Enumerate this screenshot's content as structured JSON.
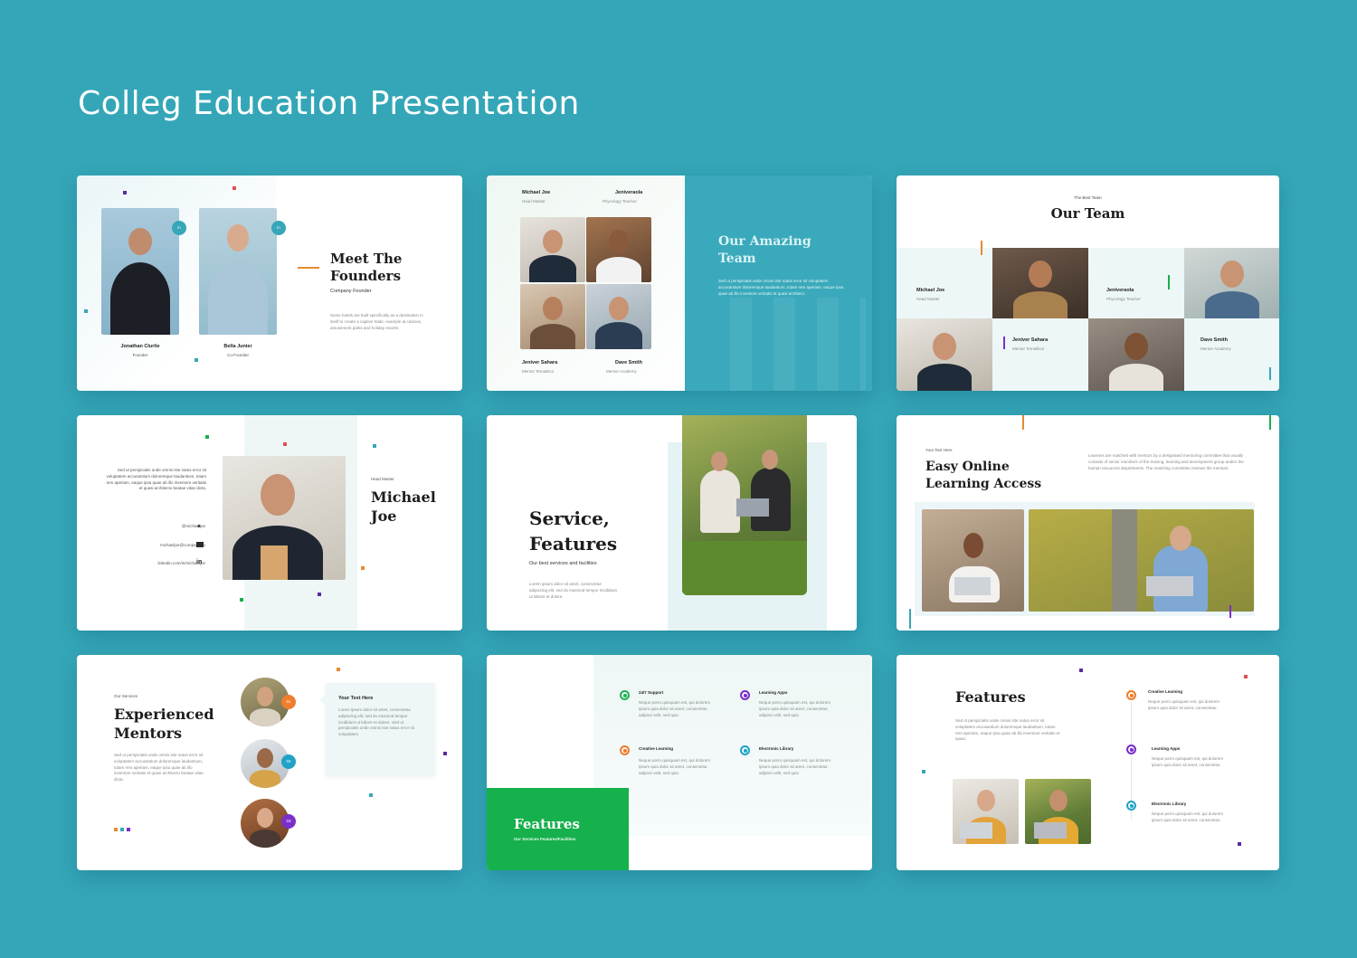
{
  "page": {
    "title": "Colleg Education Presentation"
  },
  "slides": {
    "founders": {
      "title_line1": "Meet The",
      "title_line2": "Founders",
      "subtitle": "Company Founder",
      "body": "Some hotels are built specifically as a destination in itself to create a captive trade, example at casinos, amusement parks and holiday resorts.",
      "people": [
        {
          "name": "Jonathan Clurlie",
          "role": "Founder",
          "badge": "in"
        },
        {
          "name": "Bella Junier",
          "role": "Co-Founder",
          "badge": "in"
        }
      ]
    },
    "amazing_team": {
      "title_line1": "Our Amazing",
      "title_line2": "Team",
      "body": "Sed ut perspiciatis unde omnis iste natus error sit voluptatem accusantium doloremque laudantium, totam rem aperiam, eaque ipsa quae ab illo inventore veritatis et quasi architect.",
      "members": [
        {
          "name": "Michael Joe",
          "role": "Head Master"
        },
        {
          "name": "Jeniveraola",
          "role": "Phycology Teacher"
        },
        {
          "name": "Jeniver Sahara",
          "role": "Mentor Tematikcs"
        },
        {
          "name": "Dave Smith",
          "role": "Mentor Academy"
        }
      ]
    },
    "our_team": {
      "eyebrow": "The Best Team",
      "title": "Our Team",
      "members": [
        {
          "name": "Michael Joe",
          "role": "Head Master"
        },
        {
          "name": "Jeniveraola",
          "role": "Phycology Teacher"
        },
        {
          "name": "Jeniver Sahara",
          "role": "Mentor Tematikcs"
        },
        {
          "name": "Dave Smith",
          "role": "Mentor Academy"
        }
      ]
    },
    "profile": {
      "eyebrow": "Head Master",
      "name_line1": "Michael",
      "name_line2": "Joe",
      "body": "Sed ut perspiciatis unde omnis iste natus error sit voluptatem accusantium doloremque laudantium, totam rem aperiam, eaque ipsa quae ab illo inventore veritatis et quasi architecto beatae vitae dicta.",
      "contacts": [
        {
          "text": "@michaeljoe",
          "icon": "twitter-icon"
        },
        {
          "text": "michaeljoe@company.co",
          "icon": "mail-icon"
        },
        {
          "text": "linkedin.com/in/michaeljoe",
          "icon": "linkedin-icon"
        }
      ]
    },
    "service": {
      "title_line1": "Service,",
      "title_line2": "Features",
      "subtitle": "Our best services and facilities",
      "body": "Lorem ipsum dolor sit amet, consectetur adipiscing elit, sed do eiusmod tempor incididunt ut labore et dolore."
    },
    "online": {
      "eyebrow": "Your Text Here",
      "title_line1": "Easy Online",
      "title_line2": "Learning Access",
      "body": "Learners are matched with mentors by a designated mentoring committee that usually consists of senior members of the training, learning and development group and/or the human resources departments. The matching committee reviews the mentors."
    },
    "mentors": {
      "eyebrow": "Our Services",
      "title_line1": "Experienced",
      "title_line2": "Mentors",
      "body": "Sed ut perspiciatis unde omnis iste natus error sit voluptatem accusantium doloremque laudantium, totam rem aperiam, eaque ipsa quae ab illo inventore veritatis et quasi architecto beatae vitae dicta.",
      "card_title": "Your Text Here",
      "card_body": "Lorem ipsum dolor sit amet, consectetur adipiscing elit, sed do eiusmod tempor incididunt ut labore et dolore. Sed ut perspiciatis unde omnis iste natus error sit voluptatem.",
      "badges": [
        "01",
        "02",
        "03"
      ]
    },
    "features_grid": {
      "title": "Features",
      "subtitle": "Our Services Features/Facilities",
      "items": [
        {
          "title": "24/7 Support",
          "body": "Neque porro quisquam est, qui dolorem ipsum quia dolor sit amet, consectetur, adipisci velit, sed quia",
          "color": "#22b159"
        },
        {
          "title": "Learning Apps",
          "body": "Neque porro quisquam est, qui dolorem ipsum quia dolor sit amet, consectetur, adipisci velit, sed quia",
          "color": "#7b2fc9"
        },
        {
          "title": "Creative Learning",
          "body": "Neque porro quisquam est, qui dolorem ipsum quia dolor sit amet, consectetur, adipisci velit, sed quia",
          "color": "#ef7d2c"
        },
        {
          "title": "Electronic Library",
          "body": "Neque porro quisquam est, qui dolorem ipsum quia dolor sit amet, consectetur, adipisci velit, sed quia",
          "color": "#1fa2c7"
        }
      ]
    },
    "features_list": {
      "title": "Features",
      "body": "Sed ut perspiciatis unde omnis iste natus error sit voluptatem accusantium doloremque laudantium, totam rem aperiam, eaque ipsa quae ab illo inventore veritatis et quasi.",
      "items": [
        {
          "title": "Creative Learning",
          "body": "Neque porro quisquam est, qui dolorem ipsum quia dolor sit amet, consectetur.",
          "color": "#ef7d2c"
        },
        {
          "title": "Learning Apps",
          "body": "Neque porro quisquam est, qui dolorem ipsum quia dolor sit amet, consectetur.",
          "color": "#7b2fc9"
        },
        {
          "title": "Electronic Library",
          "body": "Neque porro quisquam est, qui dolorem ipsum quia dolor sit amet, consectetur.",
          "color": "#1fa2c7"
        }
      ]
    }
  },
  "colors": {
    "background": "#34a6b8",
    "accent_teal": "#3aa9bb",
    "accent_green": "#16b04c",
    "accent_orange": "#e68a2e"
  }
}
